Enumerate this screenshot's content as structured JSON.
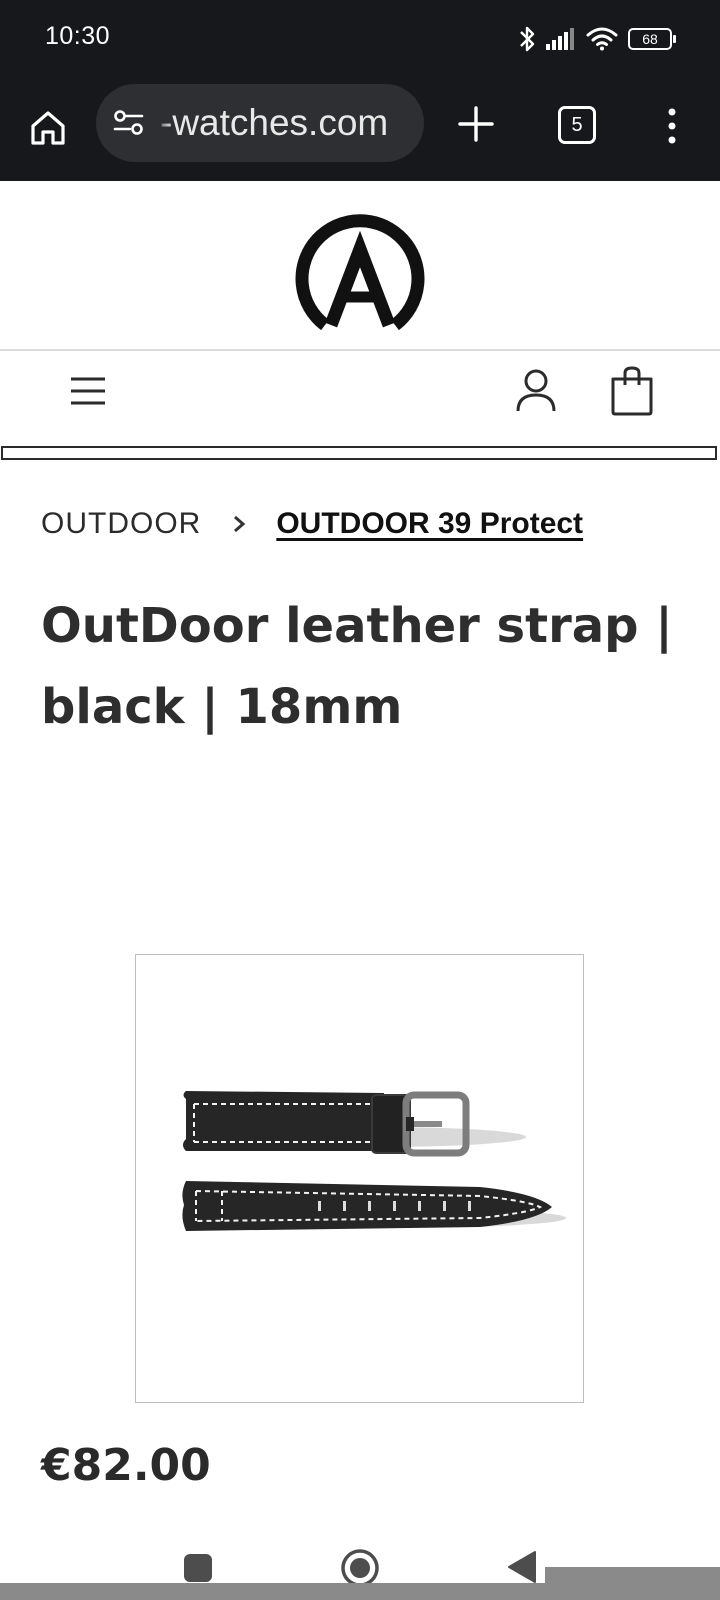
{
  "status_bar": {
    "time": "10:30",
    "battery_level": "68",
    "icons": [
      "bluetooth-icon",
      "signal-icon",
      "wifi-icon",
      "battery-icon"
    ]
  },
  "browser": {
    "url": "-watches.com",
    "tab_count": "5",
    "icons": [
      "home-icon",
      "site-settings-icon",
      "new-tab-plus-icon",
      "tab-switcher-icon",
      "more-menu-icon"
    ]
  },
  "site": {
    "logo_letter": "A",
    "header_icons": [
      "hamburger-menu-icon",
      "account-icon",
      "shopping-bag-icon"
    ]
  },
  "breadcrumb": {
    "parent": "OUTDOOR",
    "current": "OUTDOOR 39 Protect"
  },
  "product": {
    "title": "OutDoor leather strap | black | 18mm",
    "price": "€82.00",
    "image_subject": "black leather watch strap with white stitching"
  },
  "colors": {
    "system_bar": "#17181c",
    "omnibox": "#2e2f33",
    "text_dark": "#2e2e2e",
    "strap_leather": "#262626",
    "stitching": "#f2f2f2"
  }
}
